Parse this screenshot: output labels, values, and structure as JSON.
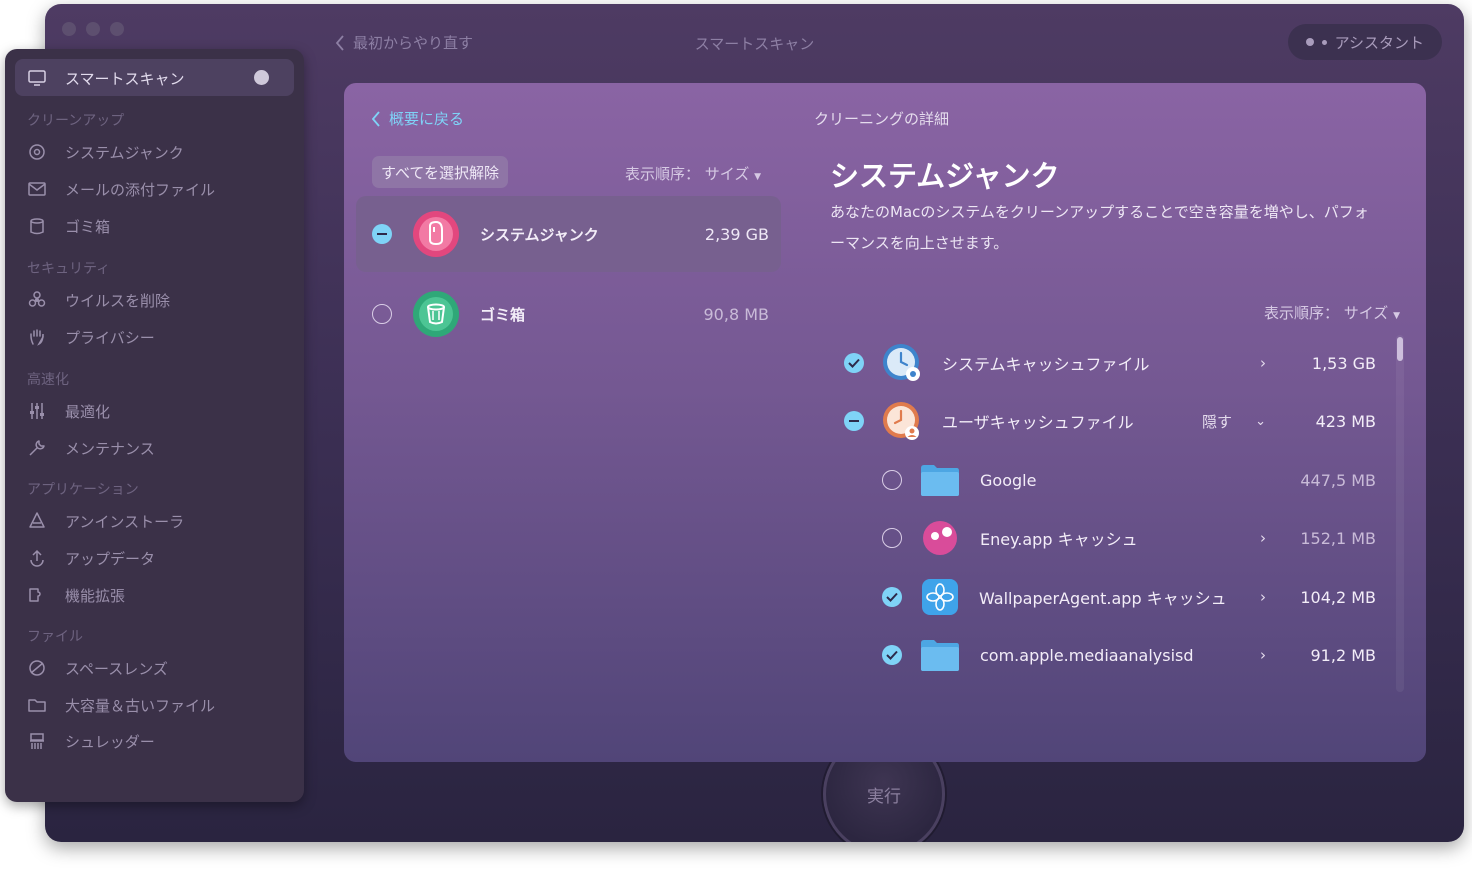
{
  "window": {
    "back_label": "最初からやり直す",
    "title": "スマートスキャン",
    "assistant_label": "アシスタント"
  },
  "sidebar": {
    "active": {
      "label": "スマートスキャン",
      "icon": "monitor-icon"
    },
    "sections": [
      {
        "heading": "クリーンアップ",
        "items": [
          {
            "label": "システムジャンク",
            "icon": "disk-icon"
          },
          {
            "label": "メールの添付ファイル",
            "icon": "mail-icon"
          },
          {
            "label": "ゴミ箱",
            "icon": "trash-icon"
          }
        ]
      },
      {
        "heading": "セキュリティ",
        "items": [
          {
            "label": "ウイルスを削除",
            "icon": "biohazard-icon"
          },
          {
            "label": "プライバシー",
            "icon": "hand-icon"
          }
        ]
      },
      {
        "heading": "高速化",
        "items": [
          {
            "label": "最適化",
            "icon": "sliders-icon"
          },
          {
            "label": "メンテナンス",
            "icon": "wrench-icon"
          }
        ]
      },
      {
        "heading": "アプリケーション",
        "items": [
          {
            "label": "アンインストーラ",
            "icon": "uninstall-icon"
          },
          {
            "label": "アップデータ",
            "icon": "update-icon"
          },
          {
            "label": "機能拡張",
            "icon": "extension-icon"
          }
        ]
      },
      {
        "heading": "ファイル",
        "items": [
          {
            "label": "スペースレンズ",
            "icon": "lens-icon"
          },
          {
            "label": "大容量＆古いファイル",
            "icon": "folder-icon"
          },
          {
            "label": "シュレッダー",
            "icon": "shredder-icon"
          }
        ]
      }
    ]
  },
  "panel": {
    "back_label": "概要に戻る",
    "detail_title": "クリーニングの詳細",
    "deselect_all": "すべてを選択解除",
    "sort_label": "表示順序：",
    "sort_value": "サイズ",
    "categories": [
      {
        "name": "システムジャンク",
        "size": "2,39 GB",
        "state": "partial"
      },
      {
        "name": "ゴミ箱",
        "size": "90,8 MB",
        "state": "unchecked"
      }
    ],
    "heading": "システムジャンク",
    "description": "あなたのMacのシステムをクリーンアップすることで空き容量を増やし、パフォーマンスを向上させます。",
    "items": [
      {
        "name": "システムキャッシュファイル",
        "size": "1,53 GB",
        "state": "checked",
        "icon": "system-cache-icon"
      },
      {
        "name": "ユーザキャッシュファイル",
        "size": "423 MB",
        "state": "partial",
        "icon": "user-cache-icon",
        "toggle": "隠す"
      },
      {
        "name": "Google",
        "size": "447,5 MB",
        "state": "unchecked",
        "icon": "folder-icon"
      },
      {
        "name": "Eney.app キャッシュ",
        "size": "152,1 MB",
        "state": "unchecked",
        "icon": "eney-app-icon"
      },
      {
        "name": "WallpaperAgent.app キャッシュ",
        "size": "104,2 MB",
        "state": "checked",
        "icon": "wallpaper-agent-icon"
      },
      {
        "name": "com.apple.mediaanalysisd",
        "size": "91,2 MB",
        "state": "checked",
        "icon": "folder-icon"
      }
    ]
  },
  "run_button": "実行",
  "colors": {
    "accent": "#7fd3f7",
    "panel_top": "#8a64a4",
    "panel_bottom": "#514578",
    "sidebar": "#3b3148"
  }
}
